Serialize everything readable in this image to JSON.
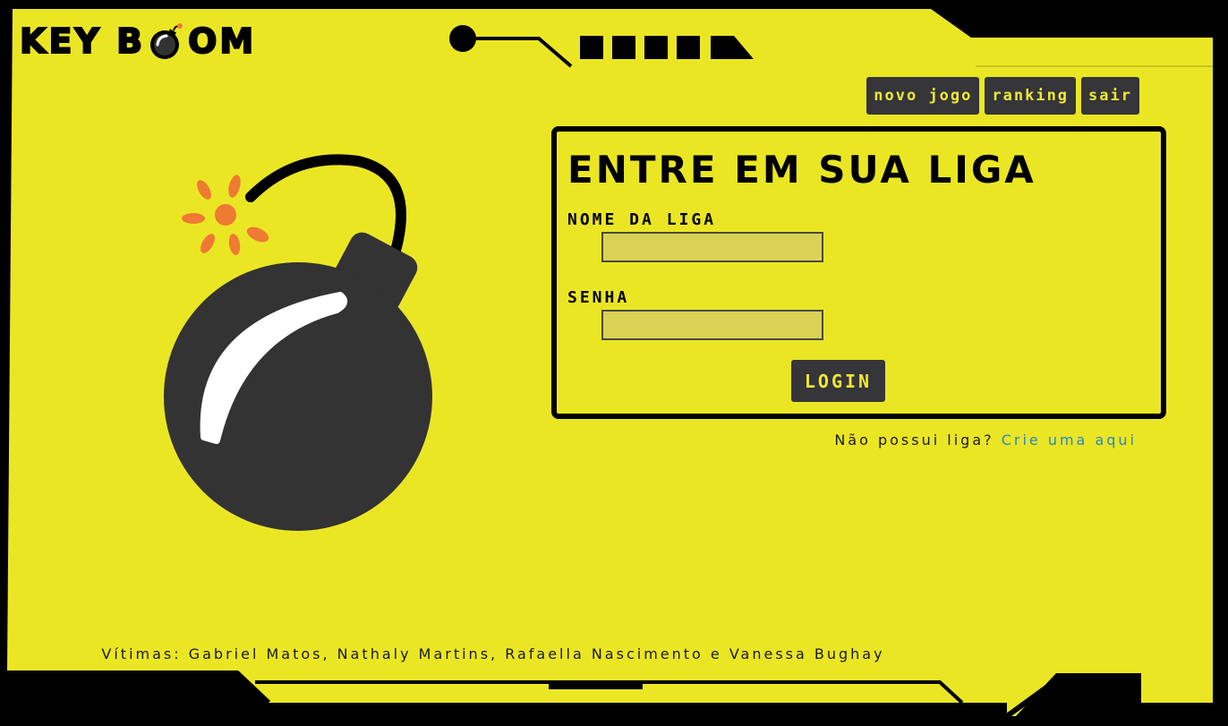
{
  "app": {
    "logo_text_left": "KEY B",
    "logo_text_right": "OM"
  },
  "nav": {
    "items": [
      {
        "label": "novo jogo"
      },
      {
        "label": "ranking"
      },
      {
        "label": "sair"
      }
    ]
  },
  "login": {
    "title": "ENTRE EM SUA LIGA",
    "league_label": "NOME DA LIGA",
    "league_value": "",
    "password_label": "SENHA",
    "password_value": "",
    "button_label": "LOGIN"
  },
  "signup": {
    "prompt": "Não possui liga?",
    "link_text": "Crie uma aqui"
  },
  "footer": {
    "credits": "Vítimas: Gabriel Matos, Nathaly Martins, Rafaella Nascimento e Vanessa Bughay"
  },
  "colors": {
    "background_yellow": "#ebe624",
    "button_dark": "#35353a",
    "button_text": "#f0e930",
    "link_blue": "#2b86c7",
    "bomb_body": "#333333",
    "spark_orange": "#ef7a33"
  }
}
